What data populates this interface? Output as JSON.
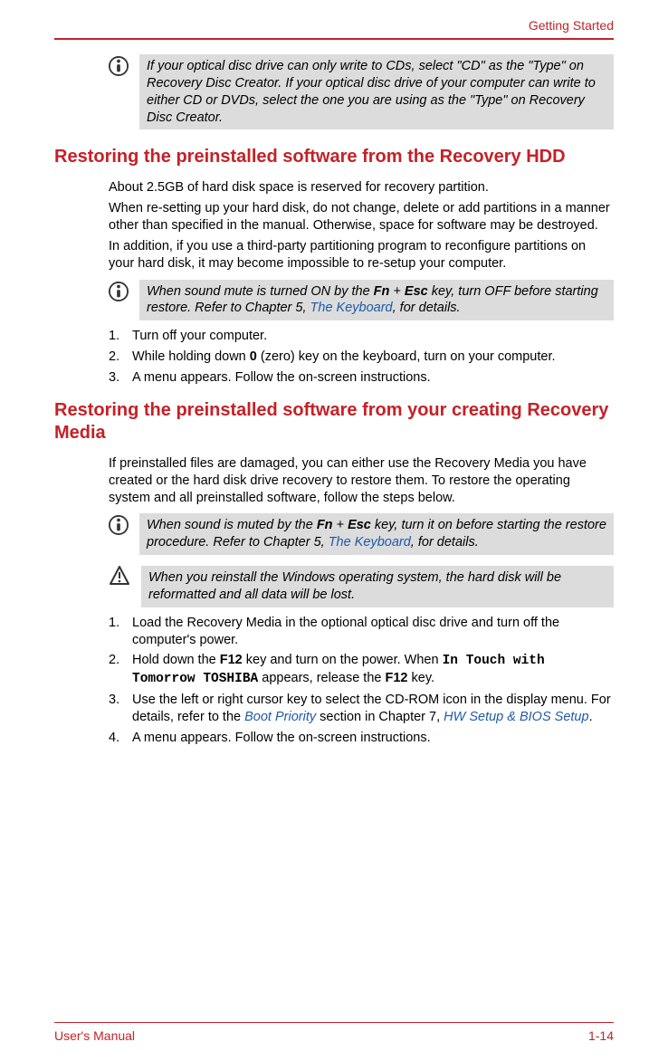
{
  "header": {
    "section_label": "Getting Started"
  },
  "note1": {
    "text": "If your optical disc drive can only write to CDs, select \"CD\" as the \"Type\" on Recovery Disc Creator. If your optical disc drive of your computer can write to either CD or DVDs, select the one you are using as the \"Type\" on Recovery Disc Creator."
  },
  "section1": {
    "heading": "Restoring the preinstalled software from the Recovery HDD",
    "p1": "About 2.5GB of hard disk space is reserved for recovery partition.",
    "p2": "When re-setting up your hard disk, do not change, delete or add partitions in a manner other than specified in the manual. Otherwise, space for software may be destroyed.",
    "p3": "In addition, if you use a third-party partitioning program to reconfigure partitions on your hard disk, it may become impossible to re-setup your computer.",
    "note": {
      "prefix": "When sound mute is turned ON by the ",
      "key1": "Fn",
      "plus": " + ",
      "key2": "Esc",
      "mid": " key, turn OFF before starting restore. Refer to Chapter 5, ",
      "link": "The Keyboard",
      "suffix": ", for details."
    },
    "steps": {
      "s1": "Turn off your computer.",
      "s2_a": "While holding down ",
      "s2_key": "0",
      "s2_b": " (zero) key on the keyboard, turn on your computer.",
      "s3": "A menu appears. Follow the on-screen instructions."
    }
  },
  "section2": {
    "heading": "Restoring the preinstalled software from your creating Recovery Media",
    "p1": "If preinstalled files are damaged, you can either use the Recovery Media you have created or the hard disk drive recovery to restore them. To restore the operating system and all preinstalled software, follow the steps below.",
    "note": {
      "prefix": "When sound is muted by the ",
      "key1": "Fn",
      "plus": " + ",
      "key2": "Esc",
      "mid": " key, turn it on before starting the restore procedure. Refer to Chapter 5, ",
      "link": "The Keyboard",
      "suffix": ", for details."
    },
    "warning": "When you reinstall the Windows operating system, the hard disk will be reformatted and all data will be lost.",
    "steps": {
      "s1": "Load the Recovery Media in the optional optical disc drive and turn off the computer's power.",
      "s2_a": "Hold down the ",
      "s2_key1": "F12",
      "s2_b": " key and turn on the power. When ",
      "s2_mono": "In Touch with Tomorrow TOSHIBA",
      "s2_c": " appears, release the ",
      "s2_key2": "F12",
      "s2_d": " key.",
      "s3_a": "Use the left or right cursor key to select the CD-ROM icon in the display menu. For details, refer to the ",
      "s3_link1": "Boot Priority",
      "s3_b": " section in Chapter 7, ",
      "s3_link2": "HW Setup & BIOS Setup",
      "s3_c": ".",
      "s4": "A menu appears. Follow the on-screen instructions."
    }
  },
  "footer": {
    "left": "User's Manual",
    "right": "1-14"
  }
}
